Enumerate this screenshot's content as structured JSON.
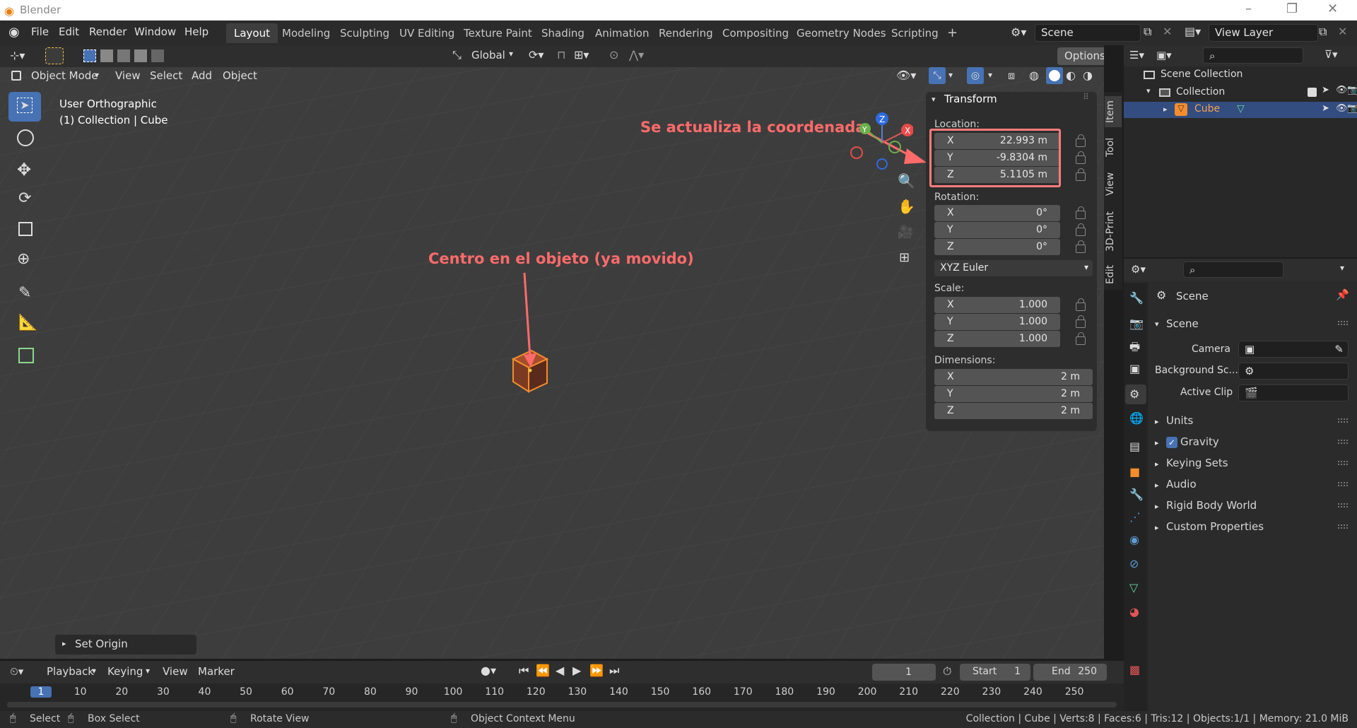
{
  "app": {
    "title": "Blender"
  },
  "topmenu": {
    "items": [
      "File",
      "Edit",
      "Render",
      "Window",
      "Help"
    ]
  },
  "workspaces": {
    "active": "Layout",
    "tabs": [
      "Layout",
      "Modeling",
      "Sculpting",
      "UV Editing",
      "Texture Paint",
      "Shading",
      "Animation",
      "Rendering",
      "Compositing",
      "Geometry Nodes",
      "Scripting"
    ],
    "add": "+"
  },
  "scene_selector": {
    "value": "Scene"
  },
  "view_layer": {
    "value": "View Layer"
  },
  "viewport_header": {
    "orientation": "Global",
    "options": "Options",
    "mode": "Object Mode",
    "menus": [
      "View",
      "Select",
      "Add",
      "Object"
    ]
  },
  "viewport": {
    "view_name": "User Orthographic",
    "context": "(1) Collection | Cube",
    "last_op": "Set Origin"
  },
  "annotations": {
    "coordinate": "Se actualiza la coordenada",
    "center": "Centro en el objeto (ya movido)"
  },
  "transform_panel": {
    "title": "Transform",
    "location_label": "Location:",
    "location": {
      "x": "22.993 m",
      "y": "-9.8304 m",
      "z": "5.1105 m"
    },
    "rotation_label": "Rotation:",
    "rotation": {
      "x": "0°",
      "y": "0°",
      "z": "0°"
    },
    "rotation_mode": "XYZ Euler",
    "scale_label": "Scale:",
    "scale": {
      "x": "1.000",
      "y": "1.000",
      "z": "1.000"
    },
    "dimensions_label": "Dimensions:",
    "dimensions": {
      "x": "2 m",
      "y": "2 m",
      "z": "2 m"
    },
    "axis": {
      "x": "X",
      "y": "Y",
      "z": "Z"
    }
  },
  "side_tabs": [
    "Item",
    "Tool",
    "View",
    "3D-Print",
    "Edit"
  ],
  "outliner": {
    "scene_collection": "Scene Collection",
    "collection": "Collection",
    "object": "Cube"
  },
  "properties": {
    "breadcrumb": "Scene",
    "section": "Scene",
    "camera_label": "Camera",
    "background_label": "Background Sc...",
    "active_clip_label": "Active Clip",
    "panels": [
      "Units",
      "Gravity",
      "Keying Sets",
      "Audio",
      "Rigid Body World",
      "Custom Properties"
    ]
  },
  "timeline": {
    "menus": [
      "Playback",
      "Keying",
      "View",
      "Marker"
    ],
    "current_frame": "1",
    "start_label": "Start",
    "start": "1",
    "end_label": "End",
    "end": "250",
    "ticks": [
      "1",
      "10",
      "20",
      "30",
      "40",
      "50",
      "60",
      "70",
      "80",
      "90",
      "100",
      "110",
      "120",
      "130",
      "140",
      "150",
      "160",
      "170",
      "180",
      "190",
      "200",
      "210",
      "220",
      "230",
      "240",
      "250"
    ]
  },
  "statusbar": {
    "select": "Select",
    "box_select": "Box Select",
    "rotate_view": "Rotate View",
    "context_menu": "Object Context Menu",
    "stats": "Collection | Cube | Verts:8 | Faces:6 | Tris:12 | Objects:1/1 | Memory: 21.0 MiB"
  },
  "colors": {
    "accent": "#4772b3",
    "selection": "#f58d2c",
    "annotation": "#ff6a6a"
  }
}
